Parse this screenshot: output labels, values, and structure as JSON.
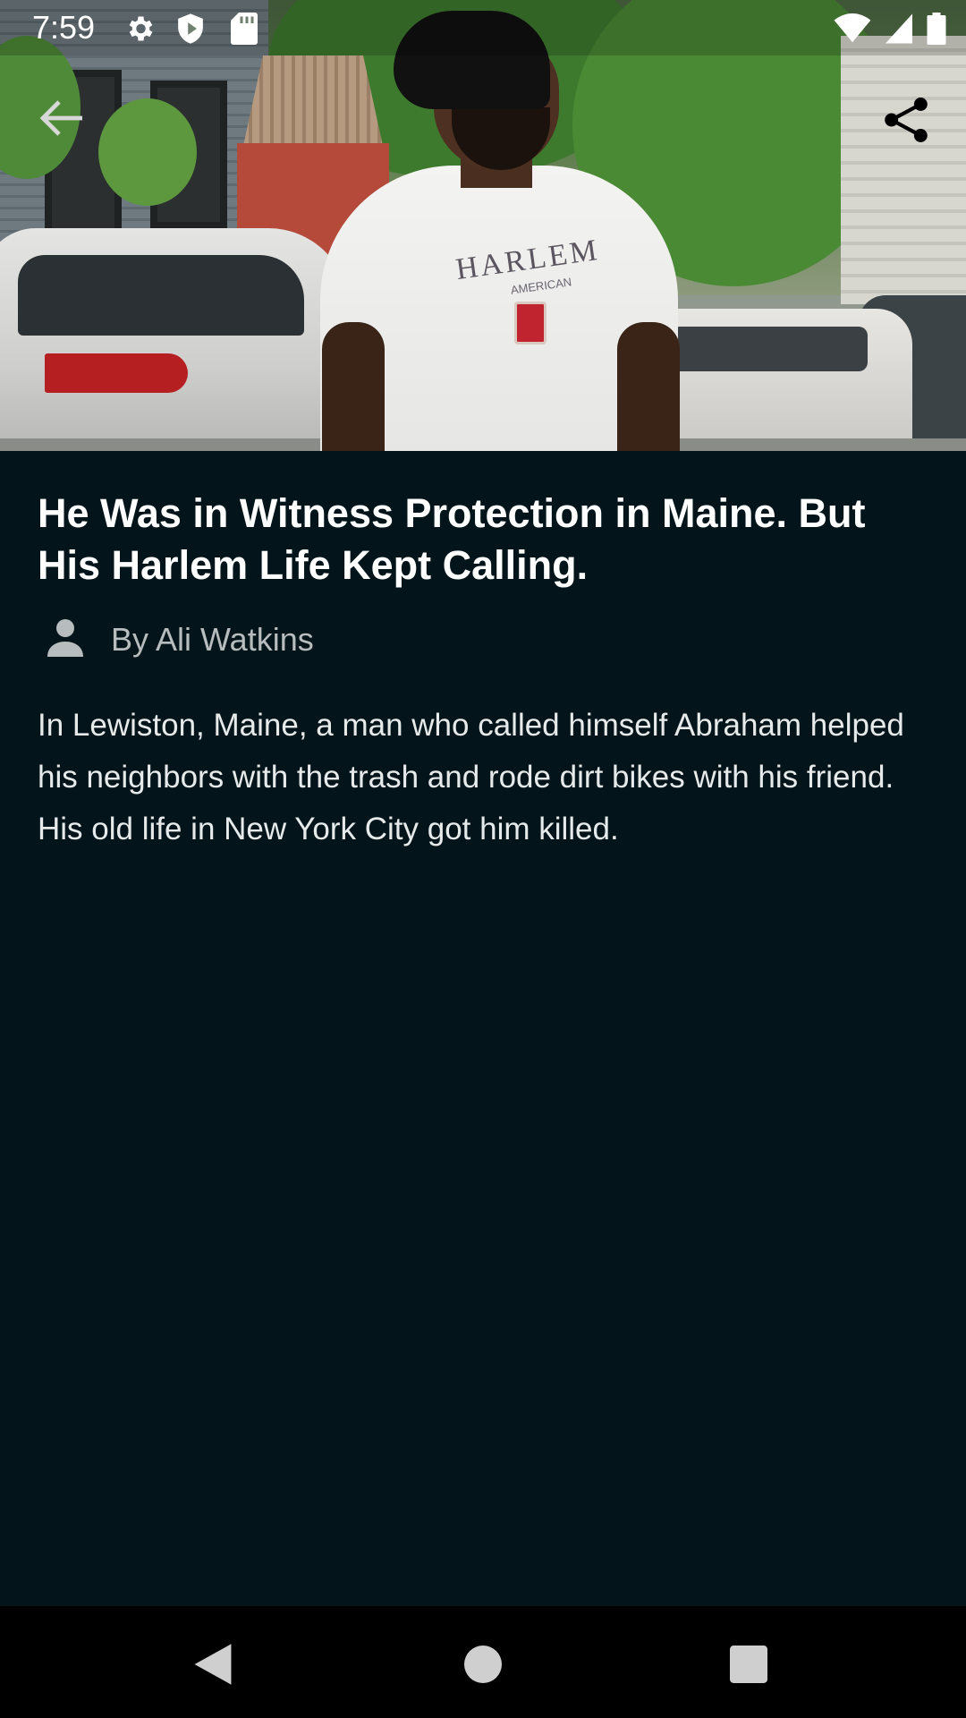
{
  "status_bar": {
    "time": "7:59",
    "left_icons": [
      "settings-icon",
      "shield-icon",
      "sd-card-icon"
    ],
    "right_icons": [
      "wifi-icon",
      "signal-icon",
      "battery-icon"
    ]
  },
  "toolbar": {
    "back_icon": "arrow-back-icon",
    "share_icon": "share-icon"
  },
  "hero": {
    "shirt_text": "HARLEM",
    "shirt_subtext": "AMERICAN"
  },
  "article": {
    "headline": "He Was in Witness Protection in Maine. But His Harlem Life Kept Calling.",
    "byline": "By Ali Watkins",
    "byline_icon": "person-icon",
    "summary": "In Lewiston, Maine, a man who called himself Abraham helped his neighbors with the trash and rode dirt bikes with his friend. His old life in New York City got him killed."
  },
  "nav_bar": {
    "buttons": [
      "back-triangle-icon",
      "home-circle-icon",
      "recents-square-icon"
    ]
  },
  "colors": {
    "background": "#03151b",
    "headline": "#ffffff",
    "byline": "#b7bcbf",
    "summary": "#e7eaeb",
    "nav_bar": "#000000"
  }
}
